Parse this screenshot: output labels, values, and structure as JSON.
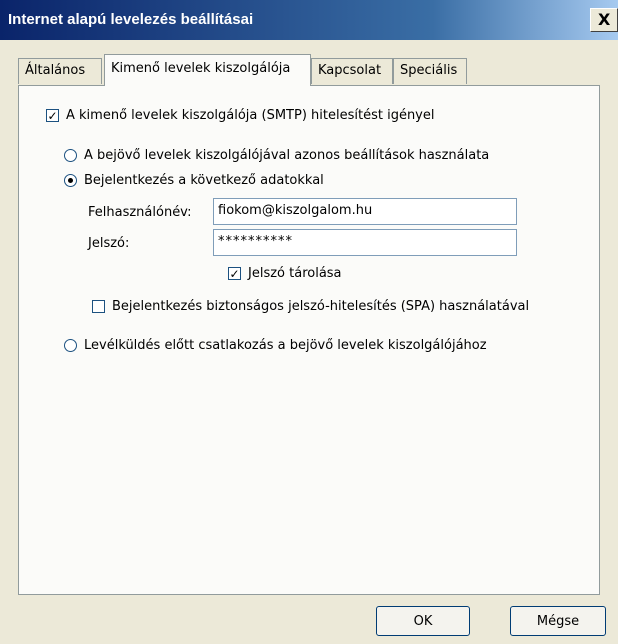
{
  "window": {
    "title": "Internet alapú levelezés beállításai",
    "close_label": "X"
  },
  "tabs": [
    {
      "label": "Általános",
      "active": false
    },
    {
      "label": "Kimenő levelek kiszolgálója",
      "active": true
    },
    {
      "label": "Kapcsolat",
      "active": false
    },
    {
      "label": "Speciális",
      "active": false
    }
  ],
  "outgoing": {
    "smtp_auth": {
      "label": "A kimenő levelek kiszolgálója (SMTP) hitelesítést igényel",
      "checked": true
    },
    "radio_same": {
      "label": "A bejövő levelek kiszolgálójával azonos beállítások használata",
      "selected": false
    },
    "radio_login": {
      "label": "Bejelentkezés a következő adatokkal",
      "selected": true
    },
    "username": {
      "label": "Felhasználónév:",
      "value": "fiokom@kiszolgalom.hu"
    },
    "password": {
      "label": "Jelszó:",
      "value": "**********"
    },
    "remember_password": {
      "label": "Jelszó tárolása",
      "checked": true
    },
    "spa": {
      "label": "Bejelentkezés biztonságos jelszó-hitelesítés (SPA) használatával",
      "checked": false
    },
    "radio_before": {
      "label": "Levélküldés előtt csatlakozás a bejövő levelek kiszolgálójához",
      "selected": false
    }
  },
  "buttons": {
    "ok": "OK",
    "cancel": "Mégse"
  }
}
